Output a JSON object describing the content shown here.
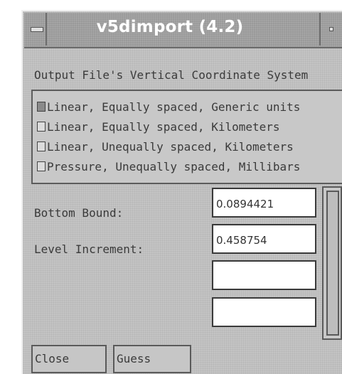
{
  "window": {
    "title": "v5dimport (4.2)"
  },
  "header": {
    "label": "Output File's Vertical Coordinate System"
  },
  "coordinate_options": [
    {
      "label": "Linear, Equally spaced, Generic units",
      "selected": true
    },
    {
      "label": "Linear, Equally spaced, Kilometers",
      "selected": false
    },
    {
      "label": "Linear, Unequally spaced, Kilometers",
      "selected": false
    },
    {
      "label": "Pressure, Unequally spaced, Millibars",
      "selected": false
    }
  ],
  "fields": {
    "bottom_bound": {
      "label": "Bottom Bound:",
      "value": "0.0894421"
    },
    "level_increment": {
      "label": "Level Increment:",
      "value": "0.458754"
    },
    "extra1": {
      "value": ""
    },
    "extra2": {
      "value": ""
    }
  },
  "buttons": {
    "close": "Close",
    "guess": "Guess"
  },
  "icons": {
    "window_menu": "window-menu-icon",
    "minimize": "minimize-icon"
  },
  "colors": {
    "titlebar": "#9a9a9a",
    "background": "#c4c4c4",
    "field_bg": "#ffffff"
  }
}
